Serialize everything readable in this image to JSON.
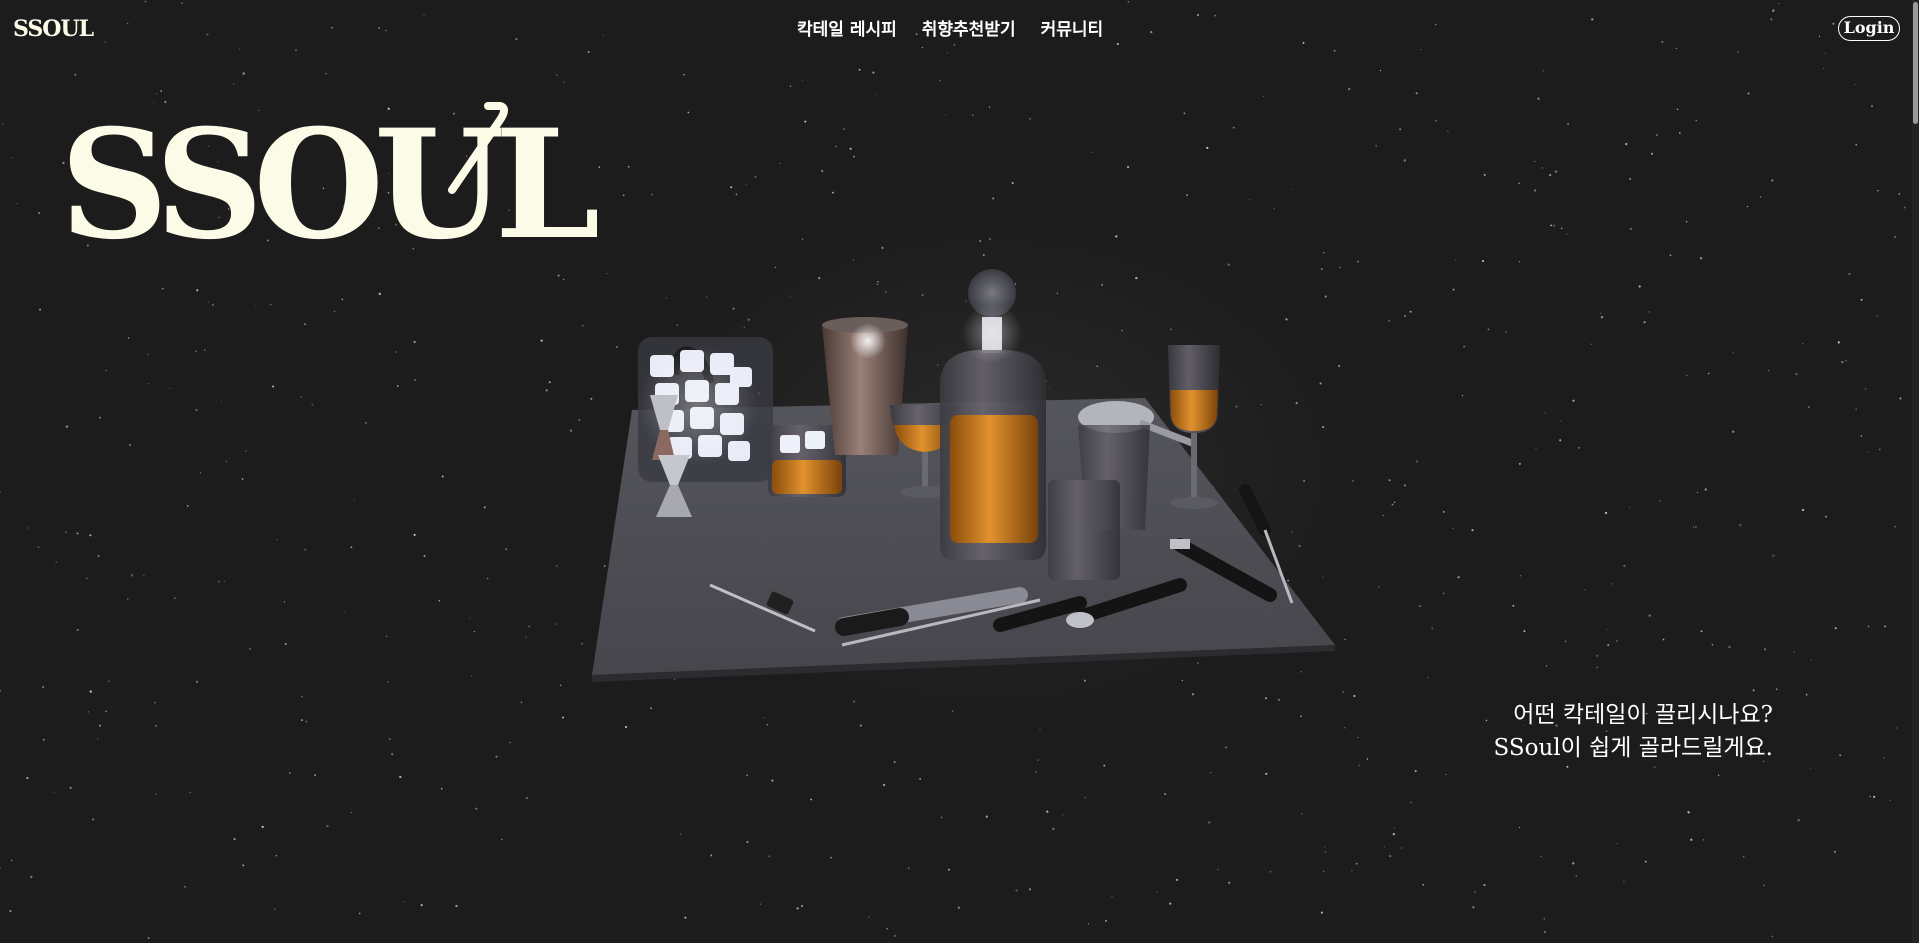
{
  "header": {
    "brand": "SSOUL",
    "nav": [
      {
        "label": "칵테일 레시피"
      },
      {
        "label": "취향추천받기"
      },
      {
        "label": "커뮤니티"
      }
    ],
    "login_label": "Login"
  },
  "hero": {
    "logo_text": "SSOUL"
  },
  "tagline": {
    "line1": "어떤 칵테일이 끌리시나요?",
    "line2": "SSoul이 쉽게 골라드릴게요."
  },
  "colors": {
    "background": "#1c1c1c",
    "logo_cream": "#fbfbe8",
    "text_white": "#ffffff",
    "amber_liquid": "#c97a1e",
    "board_gray": "#5a5a60"
  }
}
